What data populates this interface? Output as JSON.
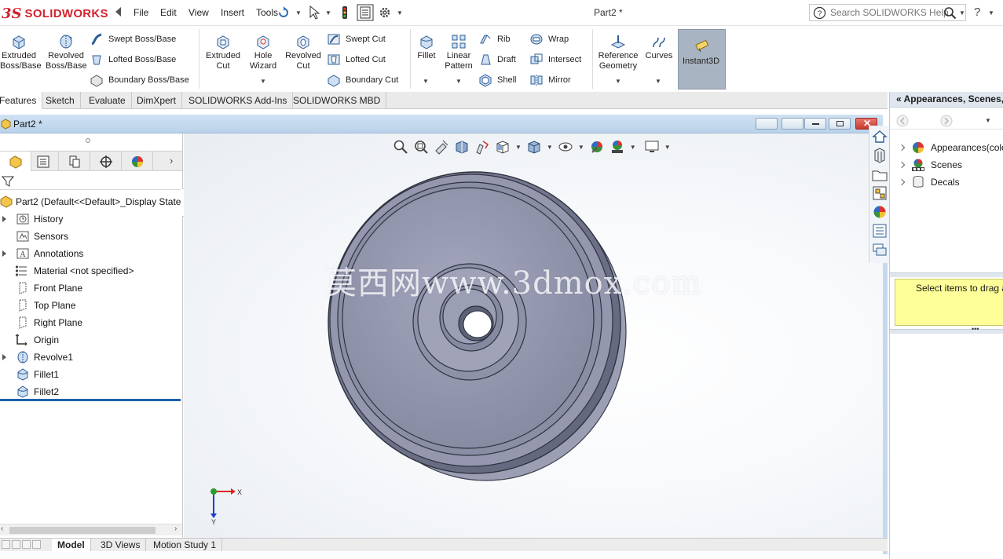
{
  "app": {
    "brand_prefix": "3S",
    "brand_name": "SOLIDWORKS",
    "document_title": "Part2 *"
  },
  "menu": {
    "items": [
      "File",
      "Edit",
      "View",
      "Insert",
      "Tools"
    ]
  },
  "search": {
    "placeholder": "Search SOLIDWORKS Help"
  },
  "help_label": "?",
  "command_manager": {
    "boss_base": [
      {
        "label_line1": "Extruded",
        "label_line2": "Boss/Base",
        "icon": "extruded-boss-icon"
      },
      {
        "label_line1": "Revolved",
        "label_line2": "Boss/Base",
        "icon": "revolved-boss-icon"
      }
    ],
    "boss_small": [
      "Swept Boss/Base",
      "Lofted Boss/Base",
      "Boundary Boss/Base"
    ],
    "cut_big": [
      {
        "label_line1": "Extruded",
        "label_line2": "Cut"
      },
      {
        "label_line1": "Hole",
        "label_line2": "Wizard"
      },
      {
        "label_line1": "Revolved",
        "label_line2": "Cut"
      }
    ],
    "cut_small": [
      "Swept Cut",
      "Lofted Cut",
      "Boundary Cut"
    ],
    "features_big": [
      {
        "label_line1": "Fillet",
        "label_line2": ""
      },
      {
        "label_line1": "Linear",
        "label_line2": "Pattern"
      }
    ],
    "features_small_a": [
      "Rib",
      "Draft",
      "Shell"
    ],
    "features_small_b": [
      "Wrap",
      "Intersect",
      "Mirror"
    ],
    "ref_big": [
      {
        "label_line1": "Reference",
        "label_line2": "Geometry"
      },
      {
        "label_line1": "Curves",
        "label_line2": ""
      }
    ],
    "instant3d": "Instant3D"
  },
  "tabs": [
    "Features",
    "Sketch",
    "Evaluate",
    "DimXpert",
    "SOLIDWORKS Add-Ins",
    "SOLIDWORKS MBD"
  ],
  "active_tab": "Features",
  "doc_window": {
    "title": "Part2 *"
  },
  "feature_tree": {
    "root": "Part2  (Default<<Default>_Display State",
    "items": [
      {
        "label": "History",
        "icon": "history-icon",
        "expandable": true
      },
      {
        "label": "Sensors",
        "icon": "sensors-icon",
        "expandable": false
      },
      {
        "label": "Annotations",
        "icon": "annotations-icon",
        "expandable": true
      },
      {
        "label": "Material <not specified>",
        "icon": "material-icon",
        "expandable": false
      },
      {
        "label": "Front Plane",
        "icon": "plane-icon",
        "expandable": false
      },
      {
        "label": "Top Plane",
        "icon": "plane-icon",
        "expandable": false
      },
      {
        "label": "Right Plane",
        "icon": "plane-icon",
        "expandable": false
      },
      {
        "label": "Origin",
        "icon": "origin-icon",
        "expandable": false
      },
      {
        "label": "Revolve1",
        "icon": "revolve-feature-icon",
        "expandable": true
      },
      {
        "label": "Fillet1",
        "icon": "fillet-feature-icon",
        "expandable": false
      },
      {
        "label": "Fillet2",
        "icon": "fillet-feature-icon",
        "expandable": false
      }
    ]
  },
  "viewport": {
    "watermark": "莫西网www.3dmox.com",
    "triad_x": "X",
    "triad_y": "Y"
  },
  "bottom_tabs": [
    "Model",
    "3D Views",
    "Motion Study 1"
  ],
  "active_bottom_tab": "Model",
  "task_pane": {
    "header": "Appearances, Scenes, and Decals",
    "items": [
      {
        "label": "Appearances(color)",
        "icon": "appearances-icon"
      },
      {
        "label": "Scenes",
        "icon": "scenes-icon"
      },
      {
        "label": "Decals",
        "icon": "decals-icon"
      }
    ],
    "hint": "Select items to drag and drop"
  },
  "colors": {
    "brand_red": "#d3232f",
    "selection_blue": "#1e61a8",
    "part_gray": "#8f93a9",
    "instant3d_active": "#a9b4c2",
    "hint_yellow": "#ffff99"
  }
}
